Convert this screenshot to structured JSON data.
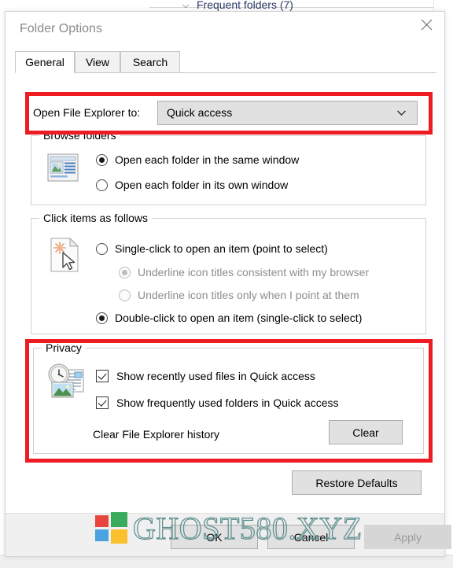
{
  "background": {
    "frequent_folders_label": "Frequent folders (7)",
    "chevron_icon": "chevron-down-icon"
  },
  "dialog": {
    "title": "Folder Options",
    "close_icon": "close-icon",
    "tabs": [
      {
        "label": "General",
        "active": true
      },
      {
        "label": "View",
        "active": false
      },
      {
        "label": "Search",
        "active": false
      }
    ],
    "open_file_explorer": {
      "label": "Open File Explorer to:",
      "value": "Quick access",
      "chevron_icon": "chevron-down-icon"
    },
    "browse_folders": {
      "legend": "Browse folders",
      "icon": "browse-folders-icon",
      "options": [
        {
          "label": "Open each folder in the same window",
          "checked": true
        },
        {
          "label": "Open each folder in its own window",
          "checked": false
        }
      ]
    },
    "click_items": {
      "legend": "Click items as follows",
      "icon": "single-click-pointer-icon",
      "options": [
        {
          "label": "Single-click to open an item (point to select)",
          "checked": false,
          "disabled": false
        },
        {
          "label": "Underline icon titles consistent with my browser",
          "checked": true,
          "disabled": true
        },
        {
          "label": "Underline icon titles only when I point at them",
          "checked": false,
          "disabled": true
        },
        {
          "label": "Double-click to open an item (single-click to select)",
          "checked": true,
          "disabled": false
        }
      ]
    },
    "privacy": {
      "legend": "Privacy",
      "icon": "recent-history-icon",
      "checkboxes": [
        {
          "label": "Show recently used files in Quick access",
          "checked": true
        },
        {
          "label": "Show frequently used folders in Quick access",
          "checked": true
        }
      ],
      "clear_label": "Clear File Explorer history",
      "clear_button": "Clear"
    },
    "restore_defaults_button": "Restore Defaults",
    "footer": {
      "ok": "OK",
      "cancel": "Cancel",
      "apply": "Apply",
      "apply_disabled": true
    }
  },
  "watermark": {
    "text": "GHOST580.XYZ",
    "logo_icon": "windows-logo-icon",
    "color": "#5f8f8f"
  },
  "colors": {
    "highlight": "#ee1c22",
    "button_face": "#e1e1e1",
    "title_text": "#8a8a8a",
    "disabled_text": "#8d8d8d"
  }
}
